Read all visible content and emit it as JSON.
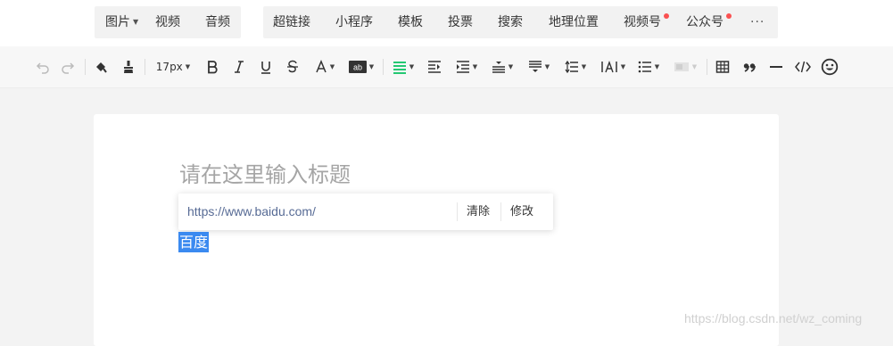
{
  "insert_bar": {
    "group1": [
      {
        "label": "图片",
        "has_caret": true
      },
      {
        "label": "视频"
      },
      {
        "label": "音频"
      }
    ],
    "group2": [
      {
        "label": "超链接"
      },
      {
        "label": "小程序"
      },
      {
        "label": "模板"
      },
      {
        "label": "投票"
      },
      {
        "label": "搜索"
      },
      {
        "label": "地理位置"
      },
      {
        "label": "视频号",
        "badge": true
      },
      {
        "label": "公众号",
        "badge": true
      },
      {
        "label": "···"
      }
    ]
  },
  "format_toolbar": {
    "font_size": "17px",
    "icons": [
      "undo-icon",
      "redo-icon",
      "format-painter-icon",
      "clear-format-icon",
      "bold-icon",
      "italic-icon",
      "underline-icon",
      "strikethrough-icon",
      "font-color-icon",
      "background-color-icon",
      "align-icon",
      "indent-icon",
      "first-line-indent-icon",
      "paragraph-spacing-before-icon",
      "paragraph-spacing-after-icon",
      "line-height-icon",
      "letter-spacing-icon",
      "list-icon",
      "border-icon",
      "table-icon",
      "quote-icon",
      "divider-icon",
      "code-icon",
      "emoji-icon"
    ],
    "accent_color": "#07c160"
  },
  "editor": {
    "title_placeholder": "请在这里输入标题",
    "link_popover": {
      "url": "https://www.baidu.com/",
      "clear_label": "清除",
      "edit_label": "修改"
    },
    "selected_text": "百度"
  },
  "watermark": "https://blog.csdn.net/wz_coming",
  "colors": {
    "link": "#576b95",
    "selection": "#3b8af0",
    "badge": "#fa5151"
  }
}
